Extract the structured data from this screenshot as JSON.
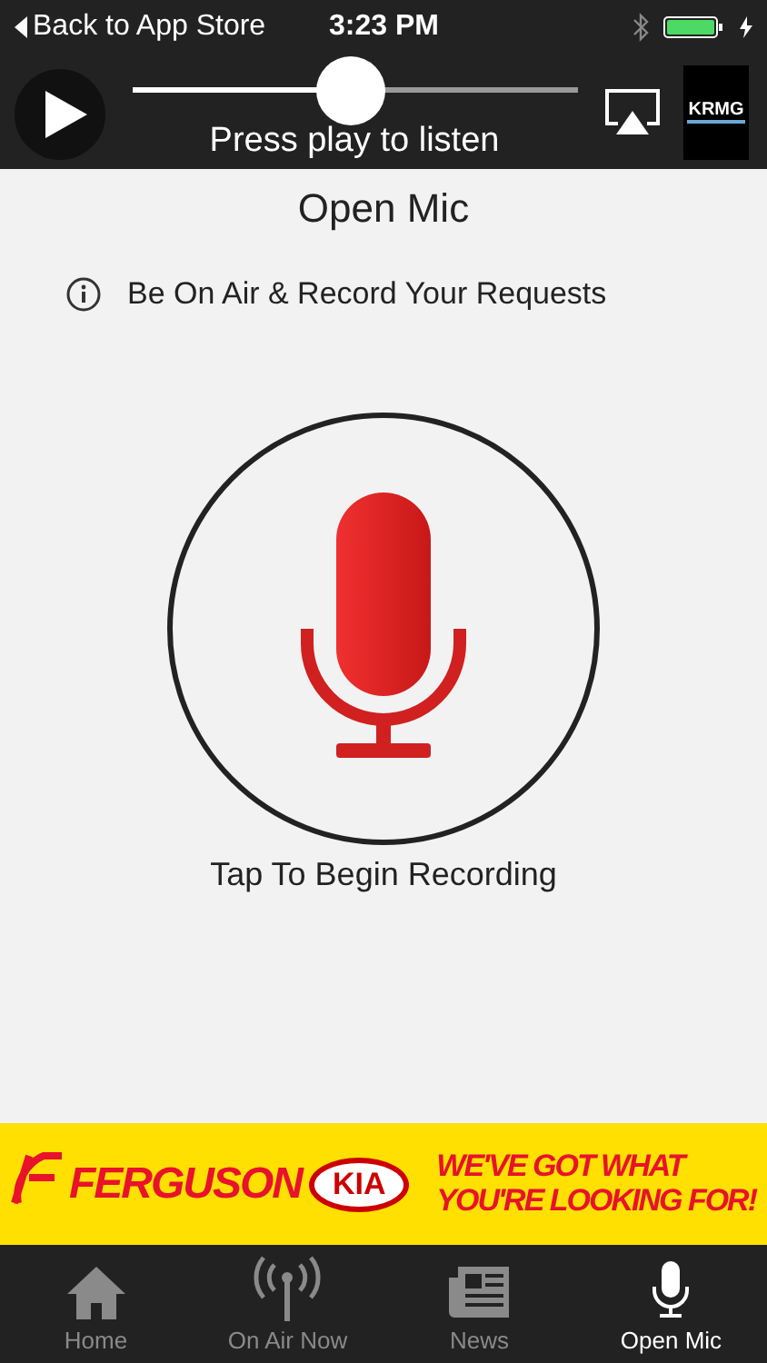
{
  "status_bar": {
    "back_label": "Back to App Store",
    "time": "3:23 PM"
  },
  "player": {
    "level": 0.49,
    "caption": "Press play to listen",
    "station_logo": "KRMG"
  },
  "page": {
    "title": "Open Mic",
    "info": "Be On Air & Record Your Requests",
    "record_label": "Tap To Begin Recording"
  },
  "ad": {
    "brand": "FERGUSON",
    "make": "KIA",
    "slogan": [
      "WE'VE GOT WHAT",
      "YOU'RE LOOKING FOR!"
    ]
  },
  "tabs": [
    {
      "kind": "home",
      "label": "Home",
      "selected": false
    },
    {
      "kind": "antenna",
      "label": "On Air Now",
      "selected": false
    },
    {
      "kind": "news",
      "label": "News",
      "selected": false
    },
    {
      "kind": "mic",
      "label": "Open Mic",
      "selected": true
    }
  ]
}
